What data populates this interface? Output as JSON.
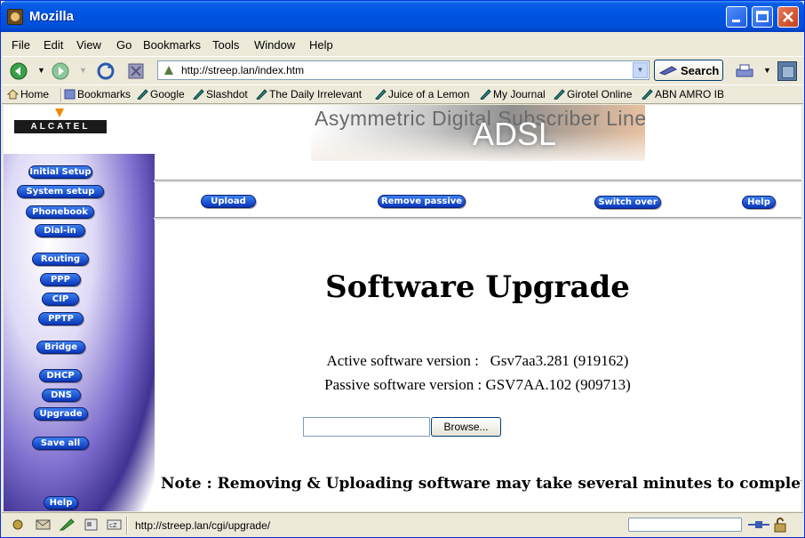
{
  "window": {
    "title": "Mozilla"
  },
  "menu": [
    "File",
    "Edit",
    "View",
    "Go",
    "Bookmarks",
    "Tools",
    "Window",
    "Help"
  ],
  "nav": {
    "url": "http://streep.lan/index.htm",
    "search_label": "Search"
  },
  "bookmarks": {
    "home": "Home",
    "items": [
      "Bookmarks",
      "Google",
      "Slashdot",
      "The Daily Irrelevant",
      "Juice of a Lemon",
      "My Journal",
      "Girotel Online",
      "ABN AMRO IB"
    ]
  },
  "page": {
    "logo": "ALCATEL",
    "banner_text": "Asymmetric Digital Subscriber Line",
    "banner_adsl": "ADSL",
    "sidebar": [
      "Initial Setup",
      "System setup",
      "Phonebook",
      "Dial-in",
      "Routing",
      "PPP",
      "CIP",
      "PPTP",
      "Bridge",
      "DHCP",
      "DNS",
      "Upgrade",
      "Save all",
      "Help"
    ],
    "top_buttons": [
      "Upload",
      "Remove passive",
      "Switch over",
      "Help"
    ],
    "title": "Software Upgrade",
    "active_version": "Active software version :   Gsv7aa3.281 (919162)",
    "passive_version": "Passive software version : GSV7AA.102 (909713)",
    "file_value": "",
    "browse_label": "Browse...",
    "note": "Note : Removing & Uploading software may take several minutes to complete"
  },
  "status": {
    "url": "http://streep.lan/cgi/upgrade/"
  },
  "colors": {
    "titlebar": "#0054e3",
    "pill": "#0a36b8",
    "logo_accent": "#f08a00"
  }
}
